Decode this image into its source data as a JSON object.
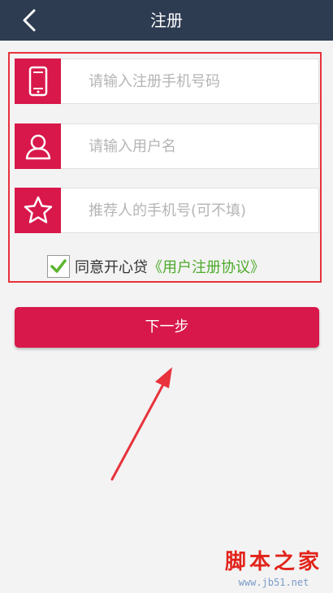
{
  "header": {
    "title": "注册"
  },
  "form": {
    "phone_placeholder": "请输入注册手机号码",
    "username_placeholder": "请输入用户名",
    "referrer_placeholder": "推荐人的手机号(可不填)"
  },
  "agreement": {
    "checked": true,
    "text": "同意开心贷",
    "link": "《用户注册协议》"
  },
  "buttons": {
    "next_label": "下一步"
  },
  "watermark": {
    "title": "脚本之家",
    "url": "www.jb51.net"
  },
  "colors": {
    "header_bg": "#2e3c52",
    "accent": "#d8184a",
    "highlight_border": "#e8323c",
    "link_green": "#4caa2a"
  },
  "icons": [
    "back-icon",
    "phone-icon",
    "user-icon",
    "star-icon",
    "check-icon"
  ]
}
